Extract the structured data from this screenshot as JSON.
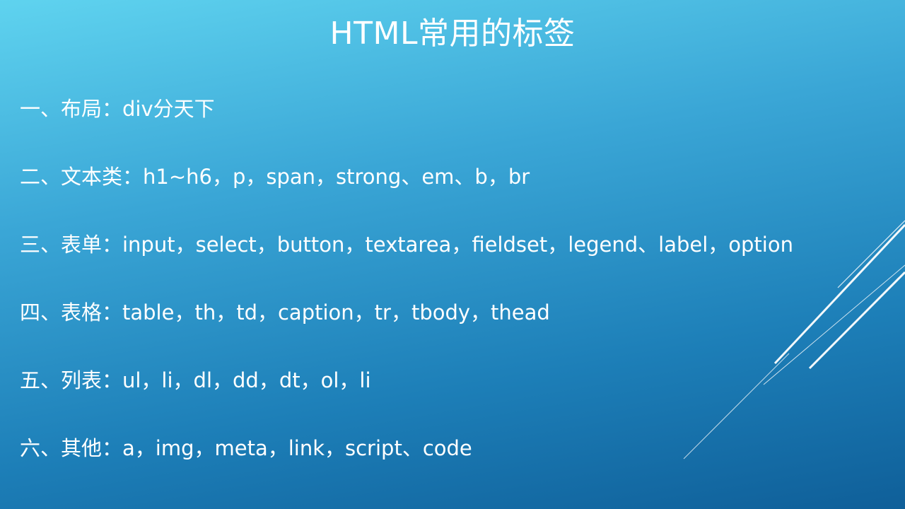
{
  "slide": {
    "title": "HTML常用的标签",
    "items": [
      "一、布局：div分天下",
      "二、文本类：h1~h6，p，span，strong、em、b，br",
      "三、表单：input，select，button，textarea，fieldset，legend、label，option",
      "四、表格：table，th，td，caption，tr，tbody，thead",
      "五、列表：ul，li，dl，dd，dt，ol，li",
      "六、其他：a，img，meta，link，script、code"
    ]
  },
  "colors": {
    "text": "#ffffff",
    "background_top": "#5fd3ef",
    "background_bottom": "#0f5f99"
  }
}
